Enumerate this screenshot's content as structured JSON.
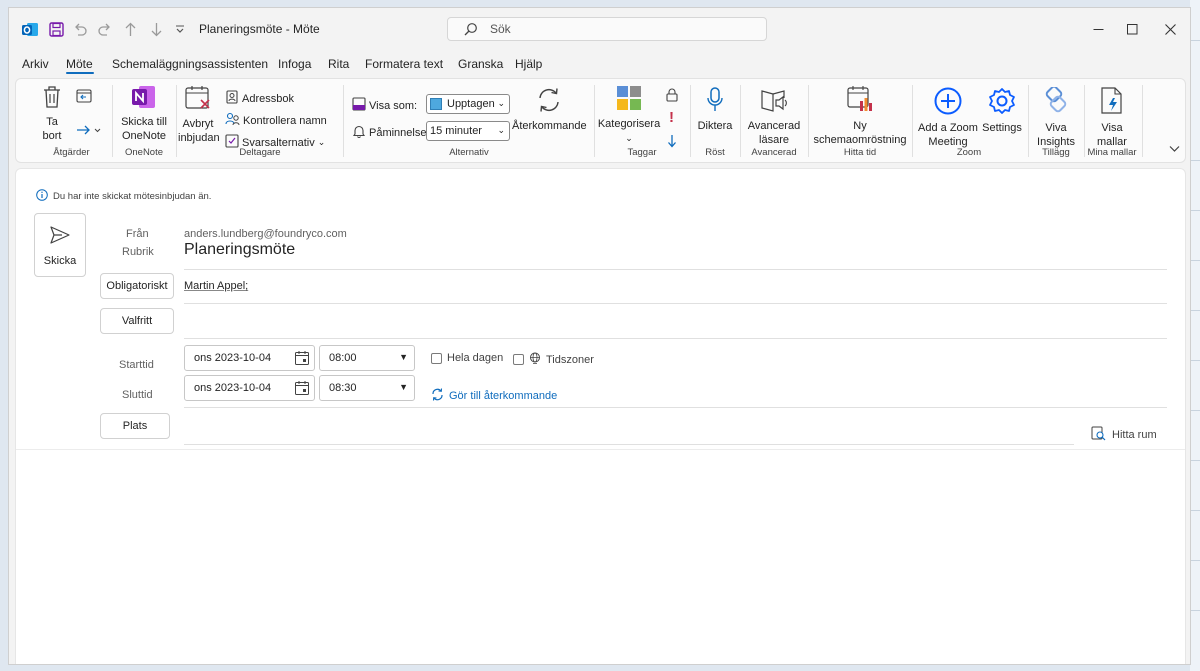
{
  "titlebar": {
    "window_title": "Planeringsmöte  -  Möte",
    "search_placeholder": "Sök"
  },
  "menu": {
    "tabs": [
      "Arkiv",
      "Möte",
      "Schemaläggningsassistenten",
      "Infoga",
      "Rita",
      "Formatera text",
      "Granska",
      "Hjälp"
    ],
    "active_tab": "Möte"
  },
  "ribbon": {
    "delete_line1": "Ta",
    "delete_line2": "bort",
    "group_actions": "Åtgärder",
    "onenote_line1": "Skicka till",
    "onenote_line2": "OneNote",
    "group_onenote": "OneNote",
    "cancel_line1": "Avbryt",
    "cancel_line2": "inbjudan",
    "addressbook": "Adressbok",
    "checknames": "Kontrollera namn",
    "response": "Svarsalternativ",
    "group_attendees": "Deltagare",
    "showas_label": "Visa som:",
    "showas_value": "Upptagen",
    "reminder_label": "Påminnelse:",
    "reminder_value": "15 minuter",
    "recurring": "Återkommande",
    "group_options": "Alternativ",
    "categorize": "Kategorisera",
    "group_tags": "Taggar",
    "dictate": "Diktera",
    "group_voice": "Röst",
    "reader_line1": "Avancerad",
    "reader_line2": "läsare",
    "group_advanced": "Avancerad",
    "poll_line1": "Ny",
    "poll_line2": "schemaomröstning",
    "group_findtime": "Hitta tid",
    "zoom_line1": "Add a Zoom",
    "zoom_line2": "Meeting",
    "zoom_settings": "Settings",
    "group_zoom": "Zoom",
    "viva_line1": "Viva",
    "viva_line2": "Insights",
    "group_addins": "Tillägg",
    "templates_line1": "Visa",
    "templates_line2": "mallar",
    "group_templates": "Mina mallar"
  },
  "form": {
    "info": "Du har inte skickat mötesinbjudan än.",
    "send": "Skicka",
    "from_label": "Från",
    "from_value": "anders.lundberg@foundryco.com",
    "subject_label": "Rubrik",
    "subject_value": "Planeringsmöte",
    "required_btn": "Obligatoriskt",
    "required_value": "Martin Appel;",
    "optional_btn": "Valfritt",
    "start_label": "Starttid",
    "start_date": "ons 2023-10-04",
    "start_time": "08:00",
    "end_label": "Sluttid",
    "end_date": "ons 2023-10-04",
    "end_time": "08:30",
    "allday": "Hela dagen",
    "timezones": "Tidszoner",
    "make_recurring": "Gör till återkommande",
    "location_btn": "Plats",
    "find_room": "Hitta rum"
  },
  "colors": {
    "accent": "#0f6cbd",
    "onenote": "#7719aa",
    "zoom": "#0b5cff",
    "delete_red": "#c4314b"
  }
}
